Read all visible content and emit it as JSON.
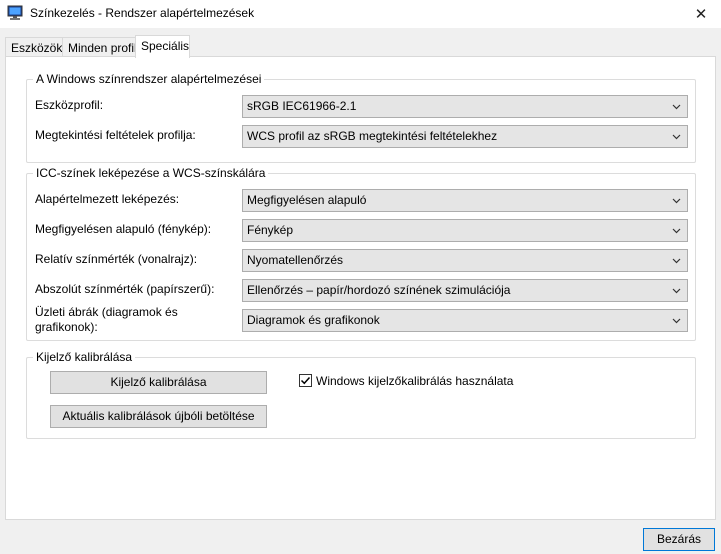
{
  "window": {
    "title": "Színkezelés - Rendszer alapértelmezések",
    "app_icon": "monitor-icon",
    "close_glyph": "✕"
  },
  "tabs": [
    {
      "label": "Eszközök",
      "active": false
    },
    {
      "label": "Minden profil",
      "active": false
    },
    {
      "label": "Speciális",
      "active": true
    }
  ],
  "windows_defaults": {
    "title": "A Windows színrendszer alapértelmezései",
    "device_profile": {
      "label": "Eszközprofil:",
      "value": "sRGB IEC61966-2.1"
    },
    "viewing_conditions": {
      "label": "Megtekintési feltételek profilja:",
      "value": "WCS profil az sRGB megtekintési feltételekhez"
    }
  },
  "icc_mapping": {
    "title": "ICC-színek leképezése a WCS-színskálára",
    "rows": [
      {
        "label": "Alapértelmezett leképezés:",
        "value": "Megfigyelésen alapuló"
      },
      {
        "label": "Megfigyelésen alapuló (fénykép):",
        "value": "Fénykép"
      },
      {
        "label": "Relatív színmérték (vonalrajz):",
        "value": "Nyomatellenőrzés"
      },
      {
        "label": "Abszolút színmérték (papírszerű):",
        "value": "Ellenőrzés – papír/hordozó színének szimulációja"
      },
      {
        "label_line1": "Üzleti ábrák (diagramok és",
        "label_line2": "grafikonok):",
        "value": "Diagramok és grafikonok"
      }
    ]
  },
  "calibration": {
    "title": "Kijelző kalibrálása",
    "calibrate_button": "Kijelző kalibrálása",
    "reload_button": "Aktuális kalibrálások újbóli betöltése",
    "use_windows_calibration": {
      "label": "Windows kijelzőkalibrálás használata",
      "checked": true
    }
  },
  "footer": {
    "close_button": "Bezárás"
  },
  "colors": {
    "focus_border": "#0078d7",
    "dropdown_bg": "#e5e5e5",
    "button_bg": "#e1e1e1"
  }
}
